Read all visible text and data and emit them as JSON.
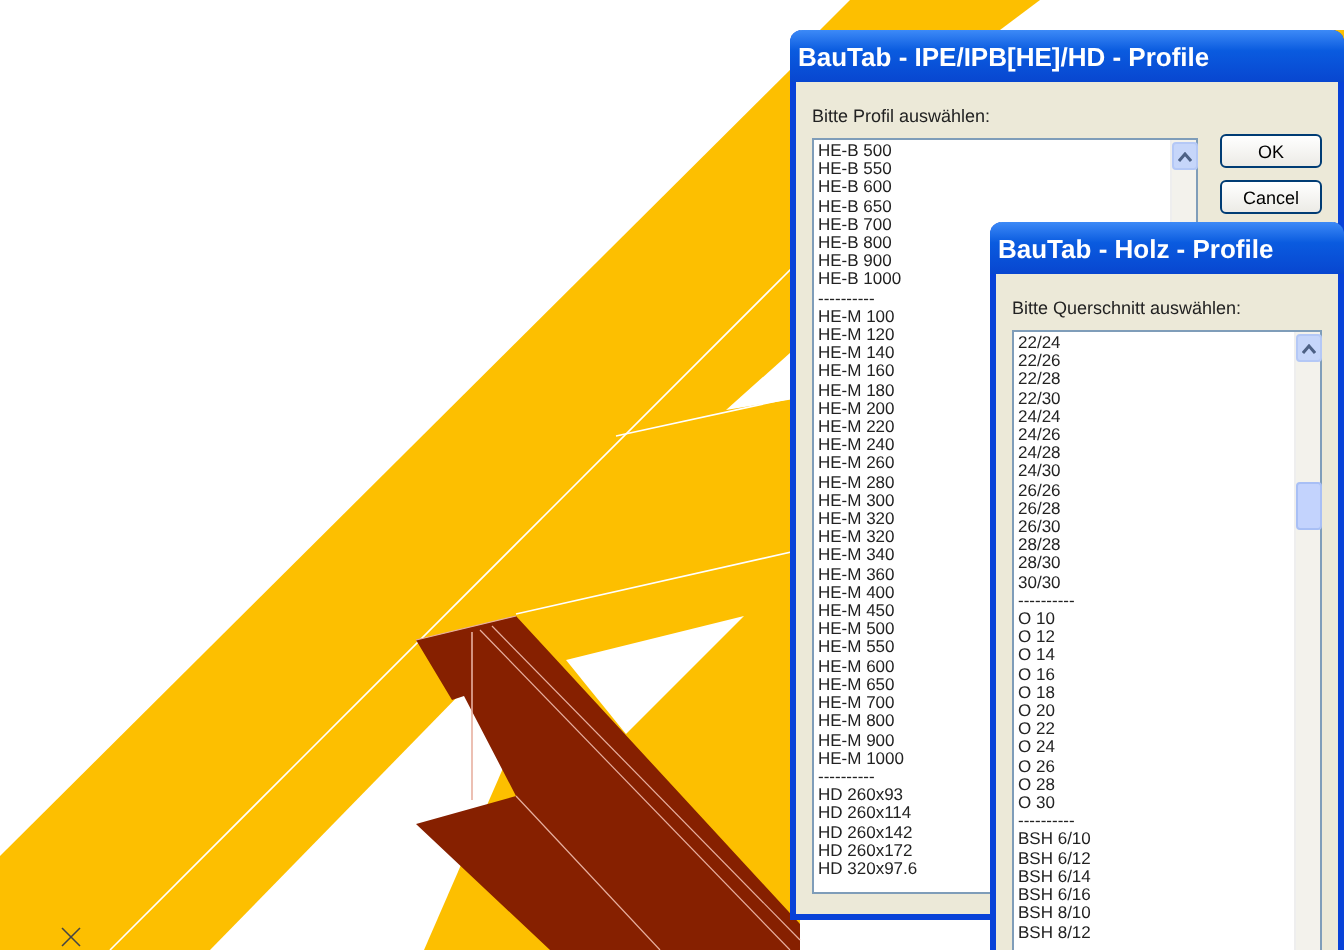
{
  "dialogs": [
    {
      "title": "BauTab - IPE/IPB[HE]/HD - Profile",
      "prompt": "Bitte Profil auswählen:",
      "buttons": [
        "OK",
        "Cancel"
      ],
      "items": [
        "HE-B 500",
        "HE-B 550",
        "HE-B 600",
        "HE-B 650",
        "HE-B 700",
        "HE-B 800",
        "HE-B 900",
        "HE-B 1000",
        "----------",
        "HE-M 100",
        "HE-M 120",
        "HE-M 140",
        "HE-M 160",
        "HE-M 180",
        "HE-M 200",
        "HE-M 220",
        "HE-M 240",
        "HE-M 260",
        "HE-M 280",
        "HE-M 300",
        "HE-M 320",
        "HE-M 320",
        "HE-M 340",
        "HE-M 360",
        "HE-M 400",
        "HE-M 450",
        "HE-M 500",
        "HE-M 550",
        "HE-M 600",
        "HE-M 650",
        "HE-M 700",
        "HE-M 800",
        "HE-M 900",
        "HE-M 1000",
        "----------",
        "HD 260x93",
        "HD 260x114",
        "HD 260x142",
        "HD 260x172",
        "HD 320x97.6"
      ]
    },
    {
      "title": "BauTab - Holz - Profile",
      "prompt": "Bitte Querschnitt auswählen:",
      "items": [
        "22/24",
        "22/26",
        "22/28",
        "22/30",
        "24/24",
        "24/26",
        "24/28",
        "24/30",
        "26/26",
        "26/28",
        "26/30",
        "28/28",
        "28/30",
        "30/30",
        "----------",
        "O 10",
        "O 12",
        "O 14",
        "O 16",
        "O 18",
        "O 20",
        "O 22",
        "O 24",
        "O 26",
        "O 28",
        "O 30",
        "----------",
        "BSH 6/10",
        "BSH 6/12",
        "BSH 6/14",
        "BSH 6/16",
        "BSH 8/10",
        "BSH 8/12"
      ]
    }
  ]
}
